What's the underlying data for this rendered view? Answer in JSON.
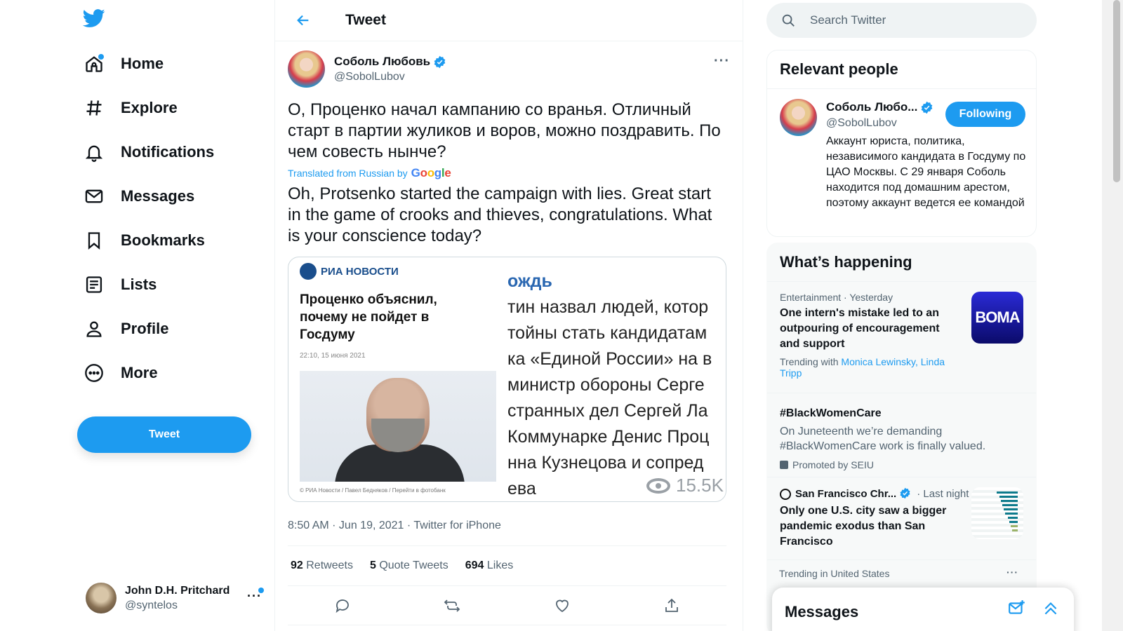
{
  "nav": {
    "items": [
      {
        "label": "Home",
        "icon": "home-icon"
      },
      {
        "label": "Explore",
        "icon": "hashtag-icon"
      },
      {
        "label": "Notifications",
        "icon": "bell-icon"
      },
      {
        "label": "Messages",
        "icon": "mail-icon"
      },
      {
        "label": "Bookmarks",
        "icon": "bookmark-icon"
      },
      {
        "label": "Lists",
        "icon": "list-icon"
      },
      {
        "label": "Profile",
        "icon": "person-icon"
      },
      {
        "label": "More",
        "icon": "more-circle-icon"
      }
    ],
    "tweet_button": "Tweet",
    "account": {
      "name": "John D.H. Pritchard",
      "handle": "@syntelos",
      "more": "···"
    }
  },
  "header": {
    "title": "Tweet"
  },
  "tweet": {
    "author_name": "Соболь Любовь",
    "author_handle": "@SobolLubov",
    "more": "···",
    "text": "О, Проценко начал кампанию со вранья. Отличный старт в партии жуликов и воров, можно поздравить. По чем совесть нынче?",
    "translated_label": "Translated from Russian by",
    "translator": "Google",
    "translation": "Oh, Protsenko started the campaign with lies. Great start in the game of crooks and thieves, congratulations. What is your conscience today?",
    "media": {
      "logo": "РИА НОВОСТИ",
      "headline": "Проценко объяснил, почему не пойдет в Госдуму",
      "date": "22:10, 15 июня 2021",
      "credit": "© РИА Новости / Павел Бедняков / Перейти в фотобанк",
      "right_lines": [
        "ождь",
        "тин назвал людей, котор",
        "тойны стать кандидатам",
        "ка «Единой России» на в",
        "министр обороны Серге",
        "странных дел Сергей Ла",
        "Коммунарке Денис Проц",
        "нна Кузнецова и сопред",
        "ева"
      ],
      "views": "15.5K"
    },
    "time": "8:50 AM",
    "date": "Jun 19, 2021",
    "source": "Twitter for iPhone",
    "stats": {
      "retweets": "92",
      "retweets_label": "Retweets",
      "quotes": "5",
      "quotes_label": "Quote Tweets",
      "likes": "694",
      "likes_label": "Likes"
    }
  },
  "search": {
    "placeholder": "Search Twitter"
  },
  "relevant": {
    "title": "Relevant people",
    "name": "Соболь Любо...",
    "handle": "@SobolLubov",
    "button": "Following",
    "bio": "Аккаунт юриста, политика, независимого кандидата в Госдуму по ЦАО Москвы. С 29 января Соболь находится под домашним арестом, поэтому аккаунт ведется ее командой"
  },
  "happening": {
    "title": "What’s happening",
    "t1": {
      "category": "Entertainment · Yesterday",
      "title": "One intern's mistake led to an outpouring of encouragement and support",
      "trending_with": "Trending with",
      "links": "Monica Lewinsky, Linda Tripp",
      "thumb_text": "BOMA"
    },
    "t2": {
      "title": "#BlackWomenCare",
      "body": "On Juneteenth we’re demanding #BlackWomenCare work is finally valued.",
      "promoted": "Promoted by SEIU"
    },
    "t3": {
      "source": "San Francisco Chr...",
      "time": "· Last night",
      "title": "Only one U.S. city saw a bigger pandemic exodus than San Francisco"
    },
    "t4": {
      "category": "Trending in United States",
      "more": "···"
    }
  },
  "messages_drawer": {
    "title": "Messages"
  }
}
